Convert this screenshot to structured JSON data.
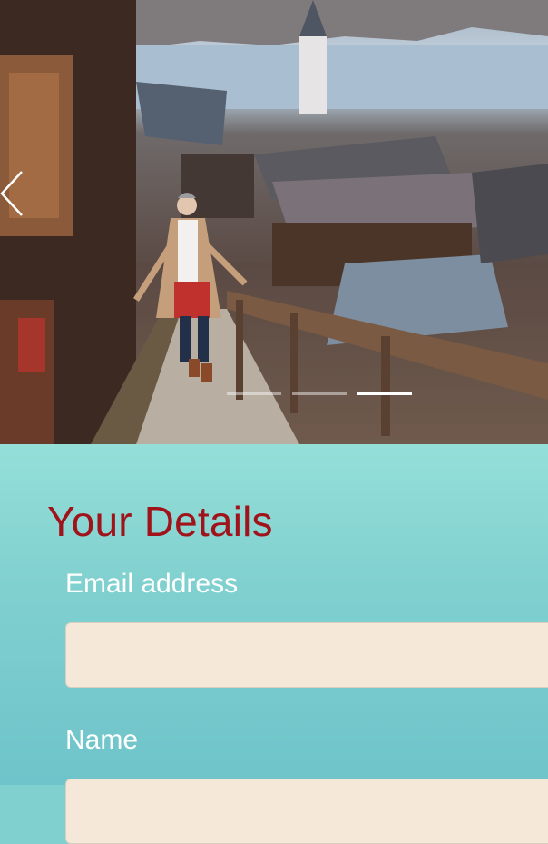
{
  "carousel": {
    "prev_icon": "chevron-left-icon",
    "slide_count": 3,
    "active_slide": 3
  },
  "form": {
    "title": "Your Details",
    "email_label": "Email address",
    "email_value": "",
    "name_label": "Name",
    "name_value": ""
  },
  "colors": {
    "title": "#a0131a",
    "input_background": "#f6e8d8",
    "panel_top": "#94dfd8",
    "panel_bottom": "#6ec4ca"
  }
}
